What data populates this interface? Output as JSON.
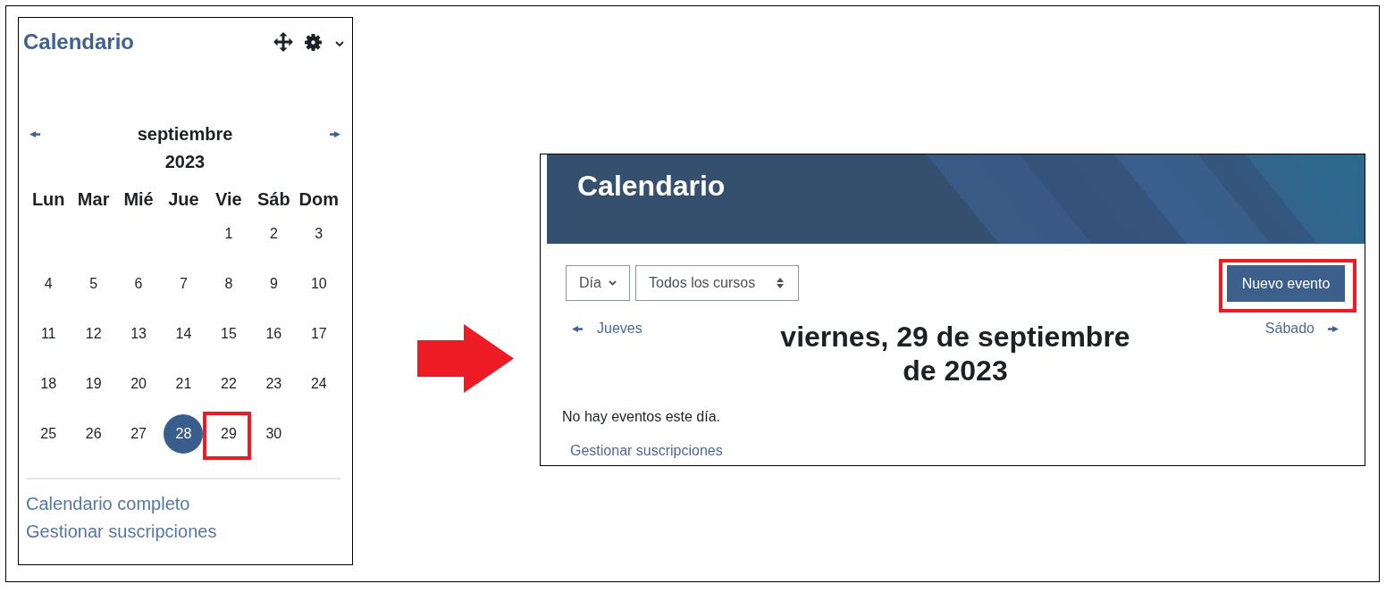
{
  "block": {
    "title": "Calendario",
    "month": "septiembre",
    "year": "2023",
    "weekdays": [
      "Lun",
      "Mar",
      "Mié",
      "Jue",
      "Vie",
      "Sáb",
      "Dom"
    ],
    "weeks": [
      {
        "kind": "first",
        "days": [
          {
            "day": "1",
            "today": false,
            "highlighted": false
          },
          {
            "day": "2",
            "today": false,
            "highlighted": false
          },
          {
            "day": "3",
            "today": false,
            "highlighted": false
          }
        ]
      },
      {
        "kind": "full",
        "days": [
          {
            "day": "4",
            "today": false,
            "highlighted": false
          },
          {
            "day": "5",
            "today": false,
            "highlighted": false
          },
          {
            "day": "6",
            "today": false,
            "highlighted": false
          },
          {
            "day": "7",
            "today": false,
            "highlighted": false
          },
          {
            "day": "8",
            "today": false,
            "highlighted": false
          },
          {
            "day": "9",
            "today": false,
            "highlighted": false
          },
          {
            "day": "10",
            "today": false,
            "highlighted": false
          }
        ]
      },
      {
        "kind": "full",
        "days": [
          {
            "day": "11",
            "today": false,
            "highlighted": false
          },
          {
            "day": "12",
            "today": false,
            "highlighted": false
          },
          {
            "day": "13",
            "today": false,
            "highlighted": false
          },
          {
            "day": "14",
            "today": false,
            "highlighted": false
          },
          {
            "day": "15",
            "today": false,
            "highlighted": false
          },
          {
            "day": "16",
            "today": false,
            "highlighted": false
          },
          {
            "day": "17",
            "today": false,
            "highlighted": false
          }
        ]
      },
      {
        "kind": "full",
        "days": [
          {
            "day": "18",
            "today": false,
            "highlighted": false
          },
          {
            "day": "19",
            "today": false,
            "highlighted": false
          },
          {
            "day": "20",
            "today": false,
            "highlighted": false
          },
          {
            "day": "21",
            "today": false,
            "highlighted": false
          },
          {
            "day": "22",
            "today": false,
            "highlighted": false
          },
          {
            "day": "23",
            "today": false,
            "highlighted": false
          },
          {
            "day": "24",
            "today": false,
            "highlighted": false
          }
        ]
      },
      {
        "kind": "last",
        "days": [
          {
            "day": "25",
            "today": false,
            "highlighted": false
          },
          {
            "day": "26",
            "today": false,
            "highlighted": false
          },
          {
            "day": "27",
            "today": false,
            "highlighted": false
          },
          {
            "day": "28",
            "today": true,
            "highlighted": false
          },
          {
            "day": "29",
            "today": false,
            "highlighted": true
          },
          {
            "day": "30",
            "today": false,
            "highlighted": false
          }
        ]
      }
    ],
    "links": [
      "Calendario completo",
      "Gestionar suscripciones"
    ]
  },
  "day_view": {
    "title": "Calendario",
    "view_select": {
      "value": "Día"
    },
    "course_select": {
      "value": "Todos los cursos"
    },
    "new_event_button": {
      "label": "Nuevo evento",
      "highlighted": true
    },
    "previous_day": "Jueves",
    "next_day": "Sábado",
    "heading": "viernes, 29 de septiembre de 2023",
    "empty_message": "No hay eventos este día.",
    "link": "Gestionar suscripciones"
  }
}
